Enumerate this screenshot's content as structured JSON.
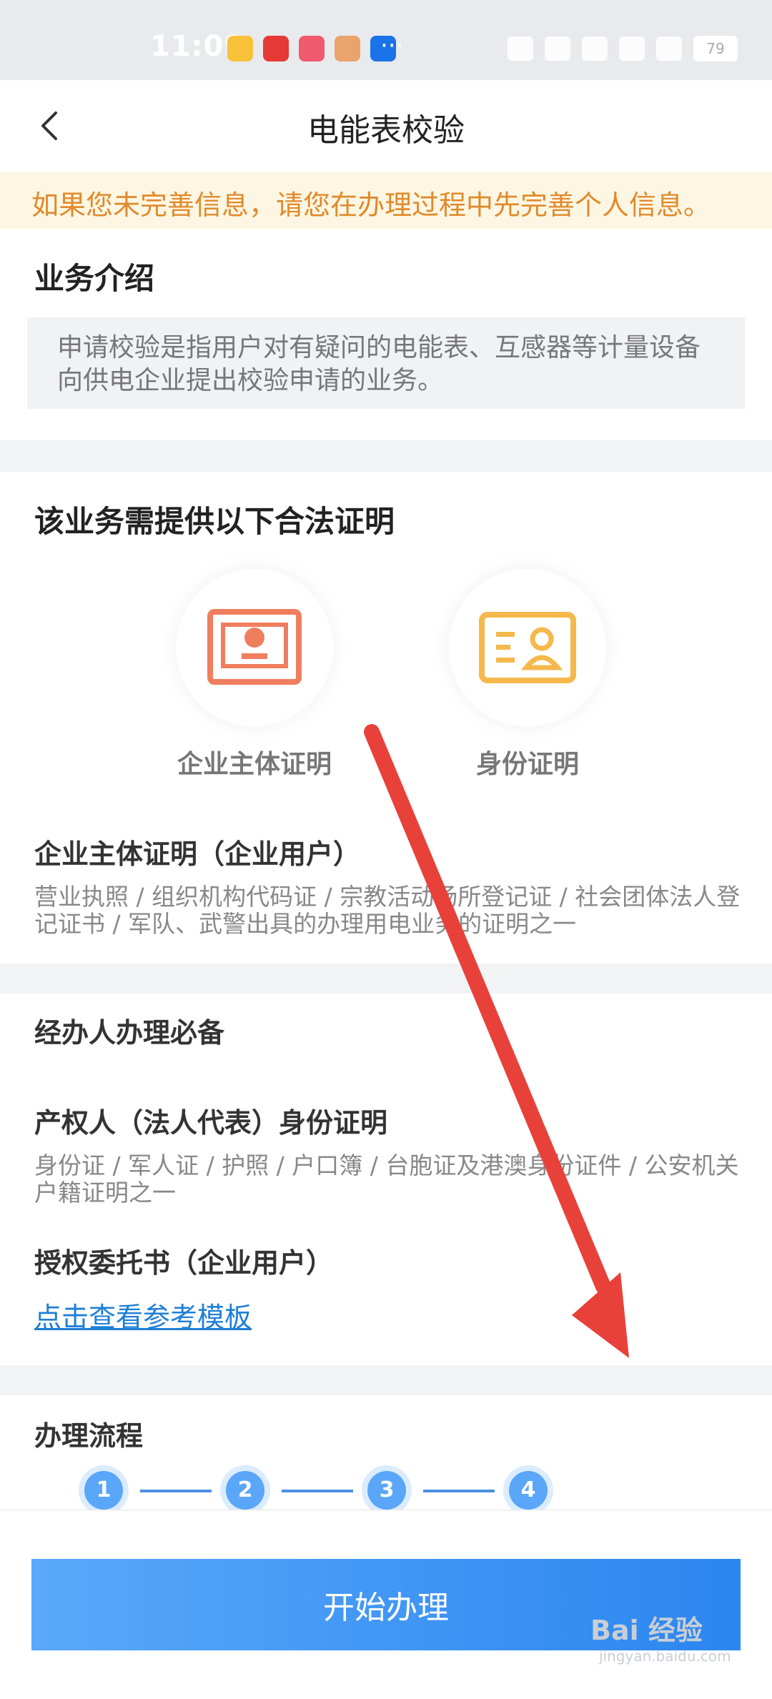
{
  "status_bar": {
    "time": "11:09",
    "more": "···",
    "battery": "79"
  },
  "nav": {
    "title": "电能表校验"
  },
  "notice": {
    "text": "如果您未完善信息，请您在办理过程中先完善个人信息。"
  },
  "intro": {
    "title": "业务介绍",
    "text": "申请校验是指用户对有疑问的电能表、互感器等计量设备向供电企业提出校验申请的业务。"
  },
  "proofs": {
    "title": "该业务需提供以下合法证明",
    "items": [
      {
        "label": "企业主体证明",
        "icon": "business-license-icon",
        "color": "#ef7e5e"
      },
      {
        "label": "身份证明",
        "icon": "id-card-icon",
        "color": "#f5b84c"
      }
    ],
    "detail_title": "企业主体证明（企业用户）",
    "detail_text": "营业执照 / 组织机构代码证 / 宗教活动场所登记证 / 社会团体法人登记证书 / 军队、武警出具的办理用电业务的证明之一"
  },
  "agent": {
    "title": "经办人办理必备",
    "id_title": "产权人（法人代表）身份证明",
    "id_text": "身份证 / 军人证 / 护照 / 户口簿 / 台胞证及港澳身份证件 / 公安机关户籍证明之一",
    "auth_title": "授权委托书（企业用户）",
    "template_link": "点击查看参考模板"
  },
  "process": {
    "title": "办理流程",
    "steps": [
      "1",
      "2",
      "3",
      "4"
    ]
  },
  "action": {
    "start_label": "开始办理"
  },
  "watermark": {
    "brand": "Bai 经验",
    "url": "jingyan.baidu.com"
  },
  "colors": {
    "primary": "#2b86ee",
    "notice_text": "#e08a2b",
    "arrow": "#e8413a"
  }
}
